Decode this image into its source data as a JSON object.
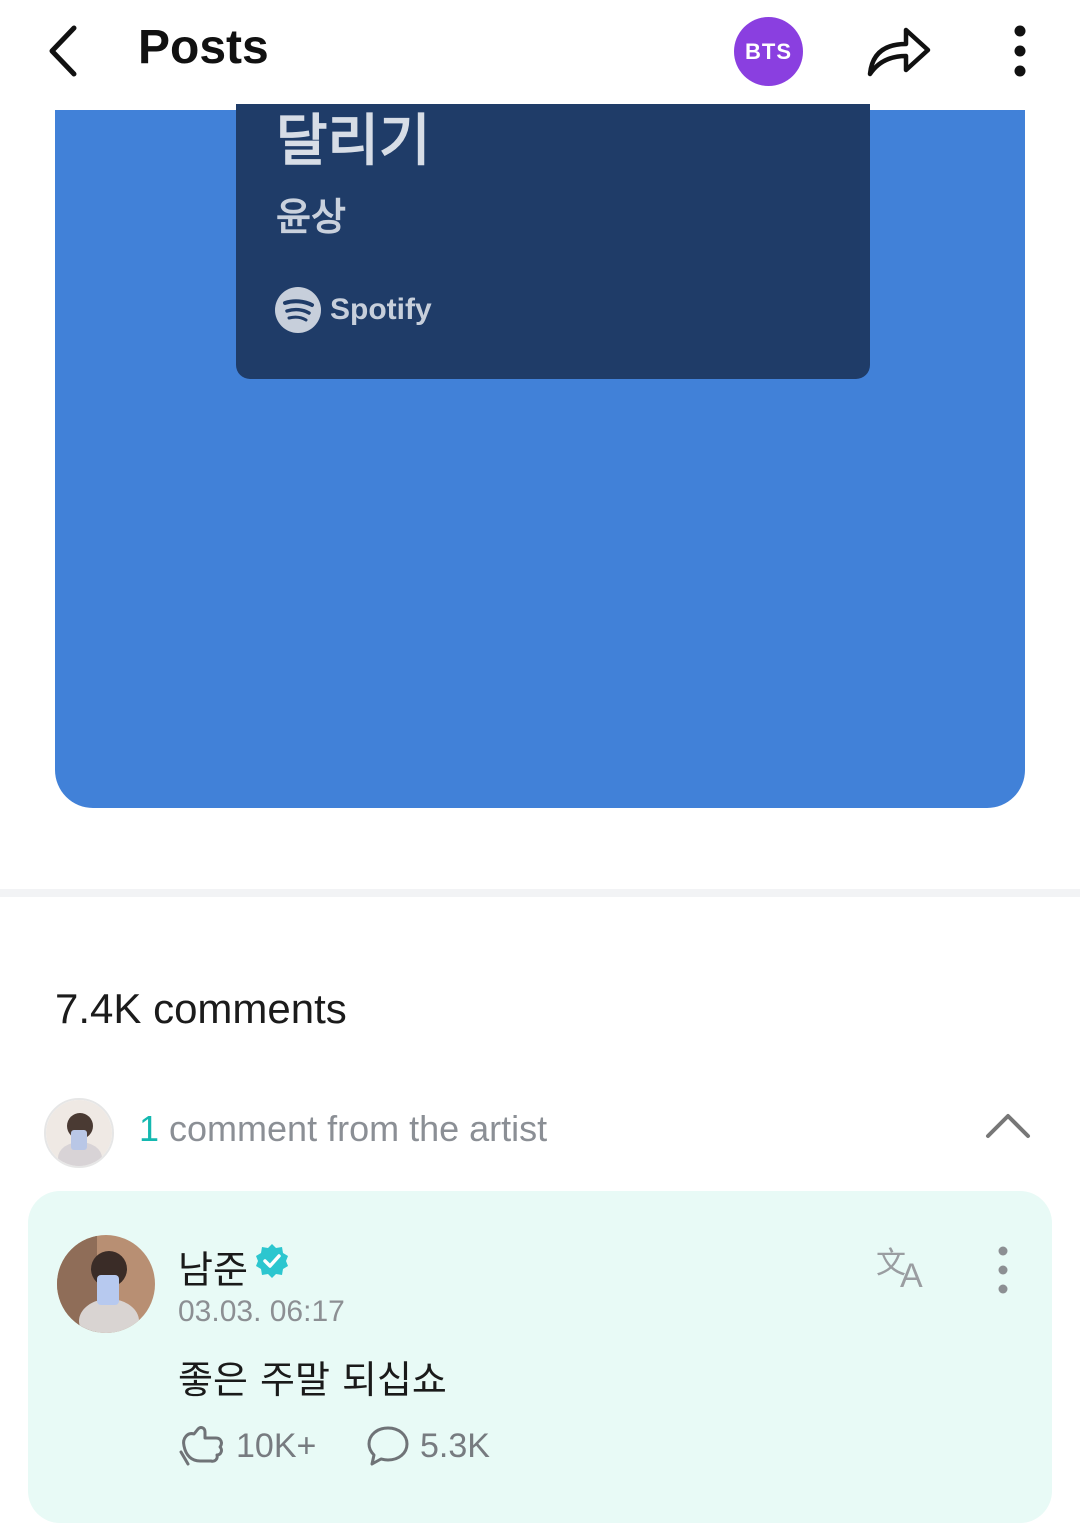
{
  "header": {
    "title": "Posts",
    "community_badge": "BTS",
    "badge_color": "#8a3fe0"
  },
  "post": {
    "media_background": "#4181d8",
    "spotify_card": {
      "track_title": "달리기",
      "artist": "윤상",
      "service": "Spotify",
      "card_color": "#1f3c68"
    }
  },
  "comments": {
    "count_label": "7.4K comments",
    "artist_section": {
      "count": "1",
      "label": " comment from the artist"
    },
    "artist_comment": {
      "author": "남준",
      "timestamp": "03.03. 06:17",
      "text": "좋은 주말 되십쇼",
      "likes": "10K+",
      "replies": "5.3K",
      "card_color": "#e8faf6"
    }
  }
}
